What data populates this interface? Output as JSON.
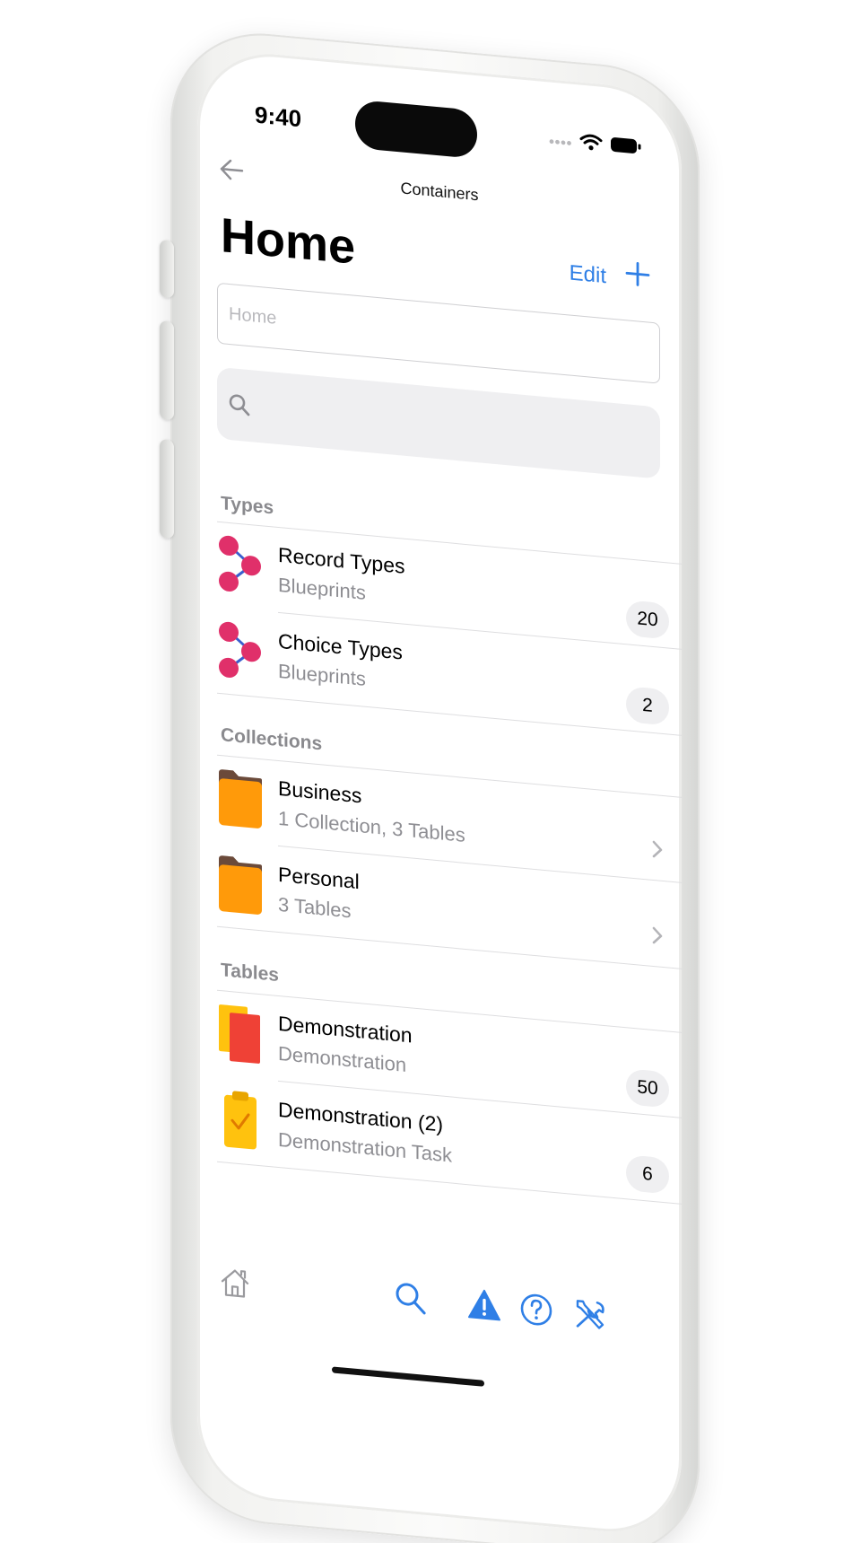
{
  "status_bar": {
    "time": "9:40"
  },
  "nav": {
    "back_icon": "arrow-left-icon",
    "title": "Containers"
  },
  "header": {
    "title": "Home",
    "edit_label": "Edit",
    "add_icon": "plus-icon"
  },
  "name_field": {
    "placeholder": "Home"
  },
  "search": {
    "icon": "search-icon",
    "placeholder": ""
  },
  "sections": {
    "types": {
      "header": "Types",
      "items": [
        {
          "title": "Record Types",
          "subtitle": "Blueprints",
          "badge": "20",
          "icon": "record-types-icon"
        },
        {
          "title": "Choice Types",
          "subtitle": "Blueprints",
          "badge": "2",
          "icon": "choice-types-icon"
        }
      ]
    },
    "collections": {
      "header": "Collections",
      "items": [
        {
          "title": "Business",
          "subtitle": "1 Collection, 3 Tables",
          "icon": "folder-icon"
        },
        {
          "title": "Personal",
          "subtitle": "3 Tables",
          "icon": "folder-icon"
        }
      ]
    },
    "tables": {
      "header": "Tables",
      "items": [
        {
          "title": "Demonstration",
          "subtitle": "Demonstration",
          "badge": "50",
          "icon": "cards-icon"
        },
        {
          "title": "Demonstration (2)",
          "subtitle": "Demonstration Task",
          "badge": "6",
          "icon": "clipboard-icon"
        }
      ]
    }
  },
  "tab_bar": {
    "items": [
      "home-icon",
      "search-icon",
      "warning-icon",
      "help-icon",
      "tools-icon"
    ]
  },
  "colors": {
    "accent": "#2f7fe6",
    "type_icon": "#e0306a",
    "folder": "#ff9a0a",
    "folder_tab": "#6b4a3a",
    "card_front": "#ef4136",
    "card_back": "#ffc20e",
    "clipboard": "#ffc20e"
  }
}
